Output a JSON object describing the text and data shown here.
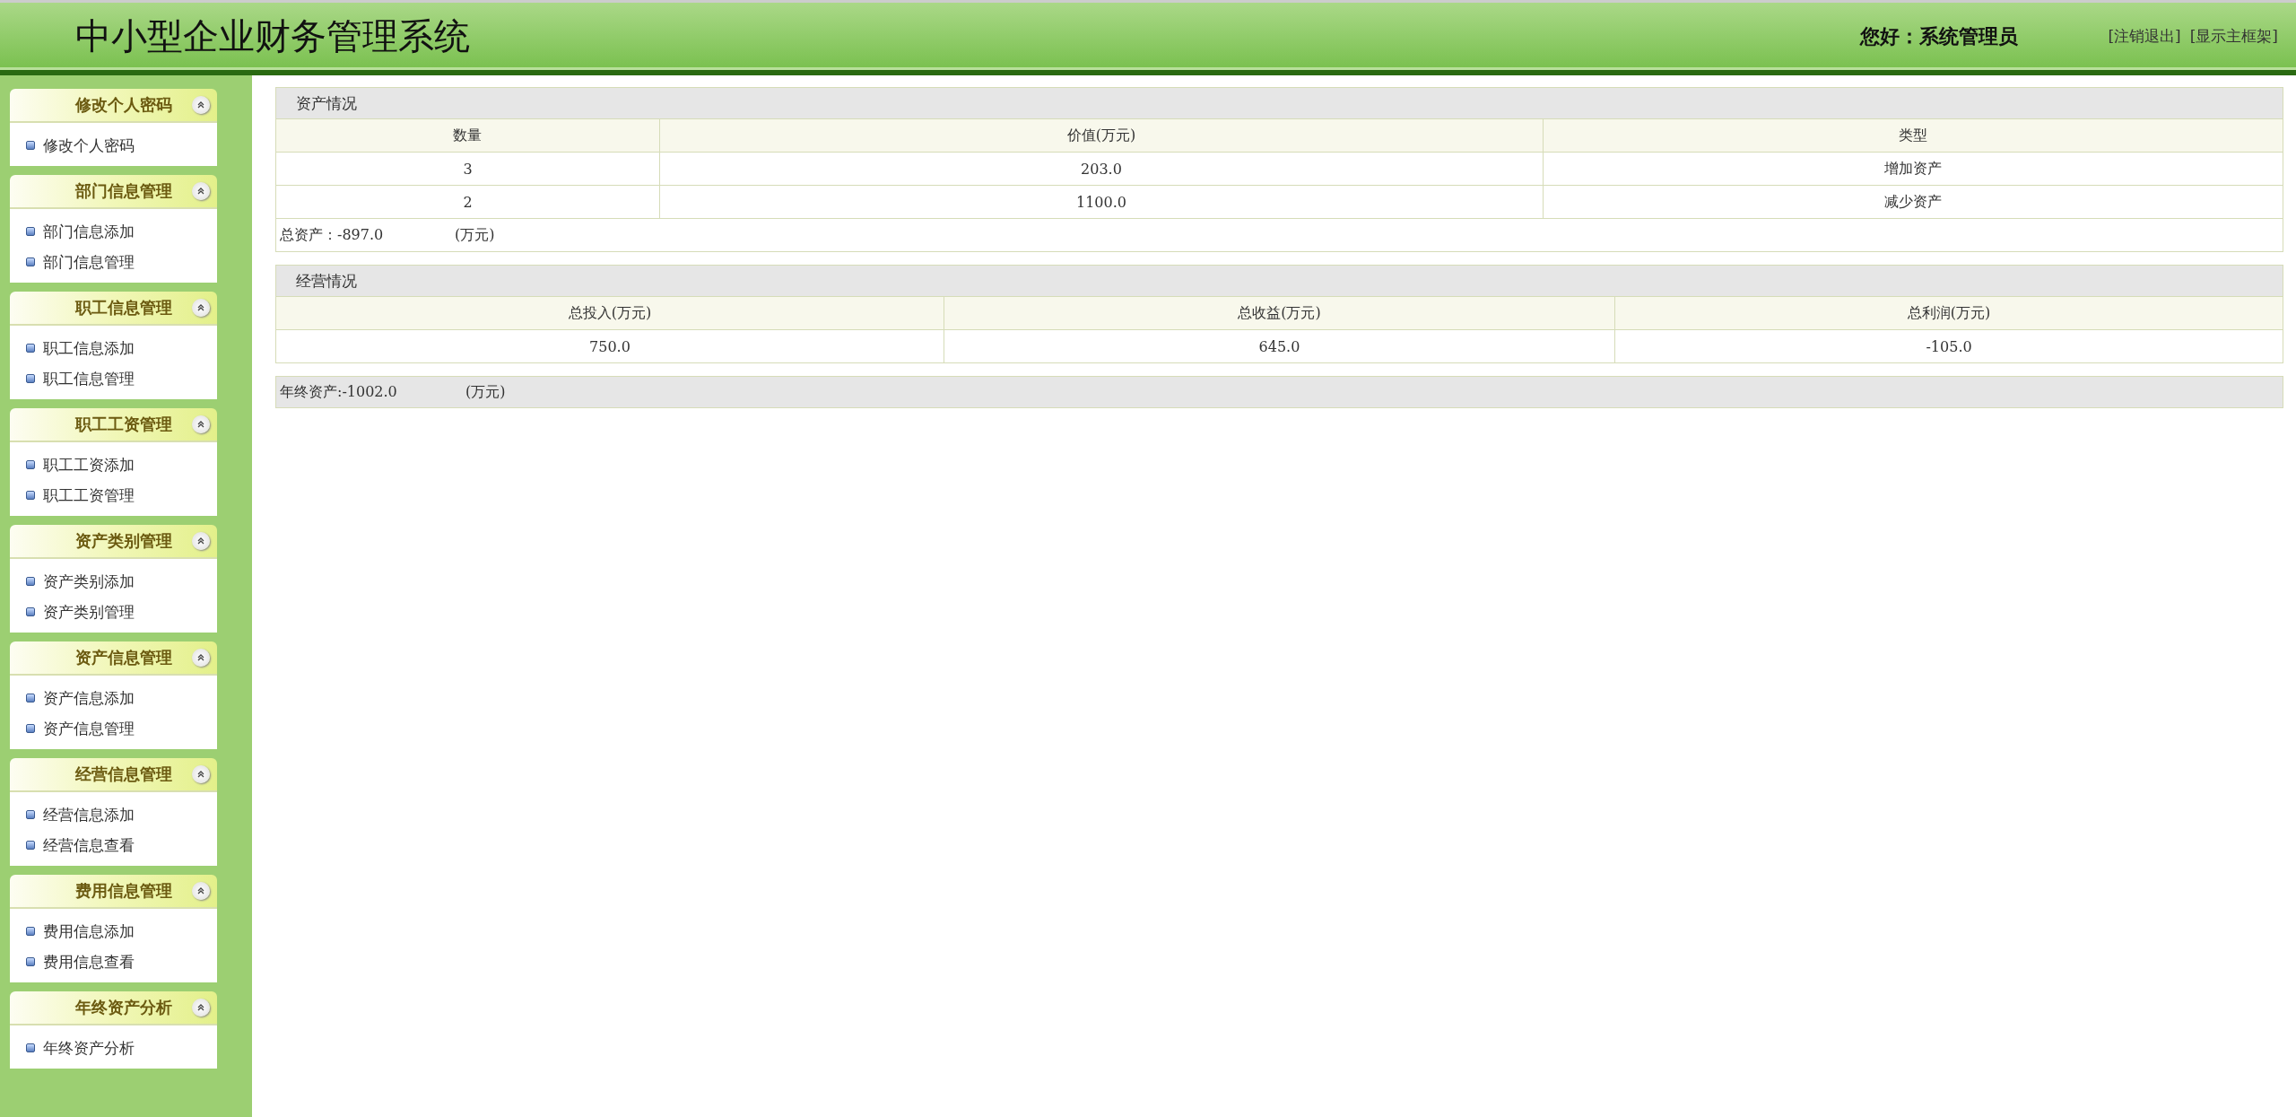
{
  "header": {
    "title": "中小型企业财务管理系统",
    "greeting": "您好：系统管理员",
    "links": [
      "[注销退出]",
      "[显示主框架]"
    ]
  },
  "sidebar": {
    "groups": [
      {
        "title": "修改个人密码",
        "expanded": true,
        "items": [
          "修改个人密码"
        ]
      },
      {
        "title": "部门信息管理",
        "expanded": true,
        "items": [
          "部门信息添加",
          "部门信息管理"
        ]
      },
      {
        "title": "职工信息管理",
        "expanded": true,
        "items": [
          "职工信息添加",
          "职工信息管理"
        ]
      },
      {
        "title": "职工工资管理",
        "expanded": true,
        "items": [
          "职工工资添加",
          "职工工资管理"
        ]
      },
      {
        "title": "资产类别管理",
        "expanded": true,
        "items": [
          "资产类别添加",
          "资产类别管理"
        ]
      },
      {
        "title": "资产信息管理",
        "expanded": true,
        "items": [
          "资产信息添加",
          "资产信息管理"
        ]
      },
      {
        "title": "经营信息管理",
        "expanded": true,
        "items": [
          "经营信息添加",
          "经营信息查看"
        ]
      },
      {
        "title": "费用信息管理",
        "expanded": true,
        "items": [
          "费用信息添加",
          "费用信息查看"
        ]
      },
      {
        "title": "年终资产分析",
        "expanded": true,
        "items": [
          "年终资产分析"
        ]
      }
    ]
  },
  "assets": {
    "title": "资产情况",
    "columns": [
      "数量",
      "价值(万元)",
      "类型"
    ],
    "rows": [
      [
        "3",
        "203.0",
        "增加资产"
      ],
      [
        "2",
        "1100.0",
        "减少资产"
      ]
    ],
    "total_label": "总资产：-897.0",
    "total_unit": "(万元)"
  },
  "operations": {
    "title": "经营情况",
    "columns": [
      "总投入(万元)",
      "总收益(万元)",
      "总利润(万元)"
    ],
    "rows": [
      [
        "750.0",
        "645.0",
        "-105.0"
      ]
    ]
  },
  "year_end": {
    "label": "年终资产:-1002.0",
    "unit": "(万元)"
  }
}
